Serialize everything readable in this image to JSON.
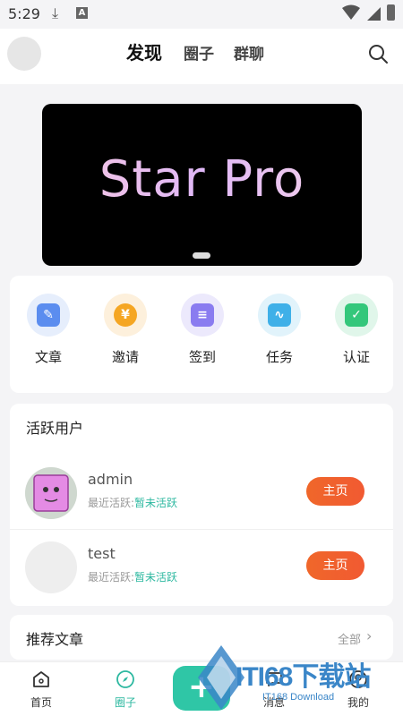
{
  "status_bar": {
    "time": "5:29"
  },
  "header": {
    "tabs": [
      {
        "label": "发现",
        "active": true
      },
      {
        "label": "圈子",
        "active": false
      },
      {
        "label": "群聊",
        "active": false
      }
    ]
  },
  "banner": {
    "text": "Star Pro"
  },
  "quick_actions": [
    {
      "label": "文章",
      "icon": "article-icon",
      "color": "#5b8def"
    },
    {
      "label": "邀请",
      "icon": "invite-icon",
      "color": "#f5a623",
      "glyph": "¥"
    },
    {
      "label": "签到",
      "icon": "checkin-icon",
      "color": "#8a7cf0"
    },
    {
      "label": "任务",
      "icon": "task-icon",
      "color": "#3fb0e8"
    },
    {
      "label": "认证",
      "icon": "verify-icon",
      "color": "#34c77b"
    }
  ],
  "active_users": {
    "title": "活跃用户",
    "users": [
      {
        "name": "admin",
        "last_active_label": "最近活跃:",
        "last_active_value": "暂未活跃",
        "button": "主页"
      },
      {
        "name": "test",
        "last_active_label": "最近活跃:",
        "last_active_value": "暂未活跃",
        "button": "主页"
      }
    ]
  },
  "recommend": {
    "title": "推荐文章",
    "all_label": "全部",
    "arrow": "›"
  },
  "bottom_nav": [
    {
      "label": "首页",
      "icon": "home-icon"
    },
    {
      "label": "圈子",
      "icon": "compass-icon",
      "active": true
    },
    {
      "label": "消息",
      "icon": "message-icon"
    },
    {
      "label": "我的",
      "icon": "profile-icon"
    }
  ],
  "add_button": {
    "label": "+"
  },
  "watermark": {
    "text": "ITI68下载站",
    "sub": "IT168 Download"
  },
  "colors": {
    "accent": "#2db8a0",
    "button": "#f15a32"
  }
}
